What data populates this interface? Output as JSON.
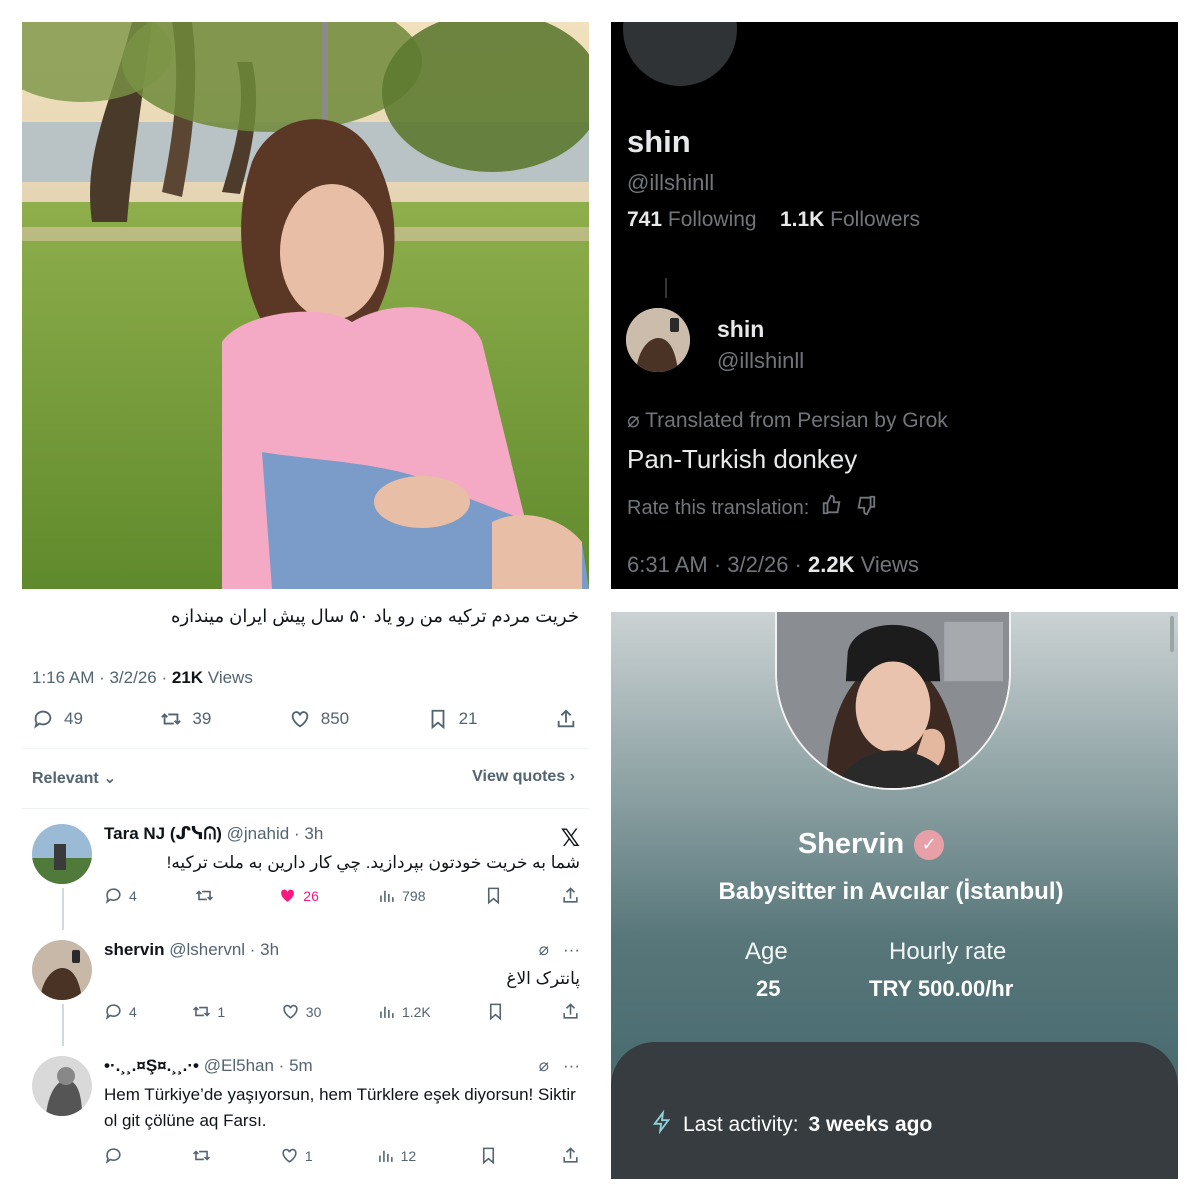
{
  "dark_profile": {
    "name": "shin",
    "handle": "@illshinll",
    "following_count": "741",
    "following_label": "Following",
    "followers_count": "1.1K",
    "followers_label": "Followers",
    "reply": {
      "name": "shin",
      "handle": "@illshinll",
      "translated_note": "Translated from Persian by Grok",
      "translation": "Pan-Turkish donkey",
      "rate_label": "Rate this translation:",
      "time": "6:31 AM · 3/2/26 · ",
      "views_count": "2.2K",
      "views_label": "Views"
    }
  },
  "main_tweet": {
    "text": "خریت مردم ترکیه من رو یاد ۵۰ سال پیش ایران میندازه",
    "time": "1:16 AM · 3/2/26 · ",
    "views_count": "21K",
    "views_label": "Views",
    "replies": "49",
    "retweets": "39",
    "likes": "850",
    "bookmarks": "21"
  },
  "filters": {
    "relevant": "Relevant",
    "view_quotes": "View quotes"
  },
  "replies": [
    {
      "name": "Tara NJ (ᔑᓭᕬ)",
      "handle": "@jnahid",
      "age": "3h",
      "text": "شما به خریت خودتون بپردازید. چي كار دارين به ملت تركيه!",
      "replies": "4",
      "retweets": "",
      "likes": "26",
      "views": "798"
    },
    {
      "name": "shervin",
      "handle": "@lshervnl",
      "age": "3h",
      "text": "پانترک الاغ",
      "replies": "4",
      "retweets": "1",
      "likes": "30",
      "views": "1.2K"
    },
    {
      "name": "•·.¸¸.¤Ş¤.¸¸.·•",
      "handle": "@El5han",
      "age": "5m",
      "text": "Hem Türkiye’de yaşıyorsun, hem Türklere eşek diyorsun! Siktir ol git çölüne aq Farsı.",
      "replies": "",
      "retweets": "",
      "likes": "1",
      "views": "12"
    }
  ],
  "sitter": {
    "name": "Shervin",
    "subtitle": "Babysitter in Avcılar (İstanbul)",
    "age_label": "Age",
    "age_value": "25",
    "rate_label": "Hourly rate",
    "rate_value": "TRY 500.00/hr",
    "activity_label": "Last activity:",
    "activity_value": "3 weeks ago"
  },
  "colors": {
    "x_dark_bg": "#000000",
    "x_muted": "#71767b",
    "x_light_muted": "#536471",
    "like_pink": "#f91880",
    "verified_pink": "#e8a0a8",
    "sitter_teal": "#3f6468"
  }
}
